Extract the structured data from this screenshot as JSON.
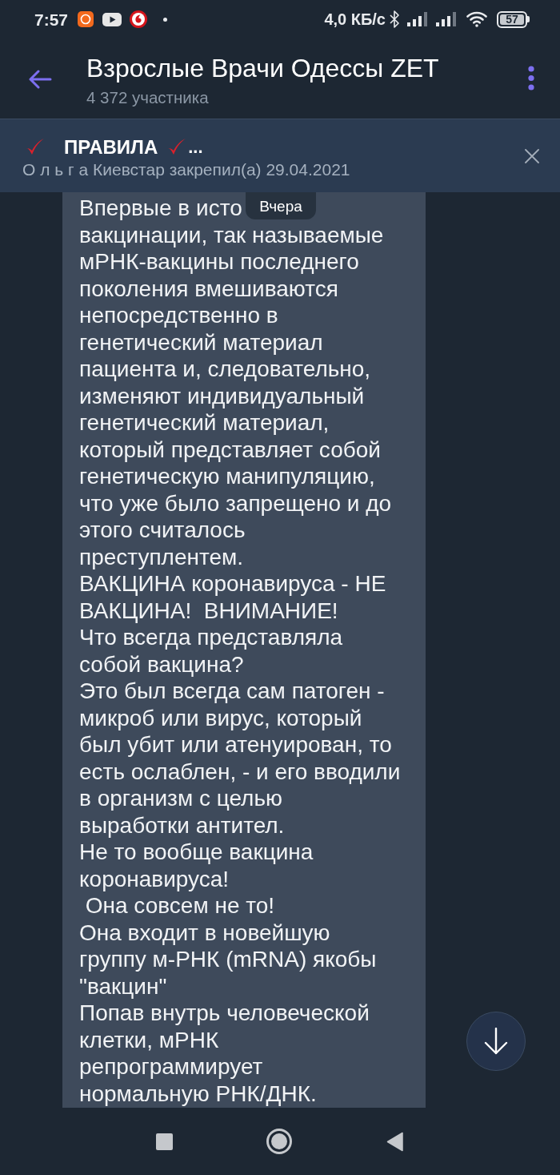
{
  "status_bar": {
    "time": "7:57",
    "network_speed": "4,0 КБ/с",
    "battery": "57"
  },
  "header": {
    "title": "Взрослые Врачи Одессы ZET",
    "subtitle": "4 372 участника"
  },
  "pinned_message": {
    "title": "ПРАВИЛА",
    "ellipsis": "...",
    "byline": "О л ь г а Киевстар закрепил(а) 29.04.2021"
  },
  "date_badge": "Вчера",
  "message": {
    "first_line": "Впервые в исто",
    "text": "вакцинации, так называемые\nмРНК-вакцины последнего\nпоколения вмешиваются\nнепосредственно в\nгенетический материал\nпациента и, следовательно,\nизменяют индивидуальный\nгенетический материал,\nкоторый представляет собой\nгенетическую манипуляцию,\nчто уже было запрещено и до\nэтого считалось\nпреступлентем.\nВАКЦИНА коронавируса - НЕ\nВАКЦИНА!  ВНИМАНИЕ!\nЧто всегда представляла\nсобой вакцина?\nЭто был всегда сам патоген -\nмикроб или вирус, который\nбыл убит или атенуирован, то\nесть ослаблен, - и его вводили\nв организм с целью\nвыработки антител.\nНе то вообще вакцина\nкоронавируса!\n Она совсем не то!\nОна входит в новейшую\nгруппу м-РНК (mRNA) якобы\n\"вакцин\"\nПопав внутрь человеческой\nклетки, мРНК\nрепрограммирует\nнормальную РНК/ДНК."
  }
}
